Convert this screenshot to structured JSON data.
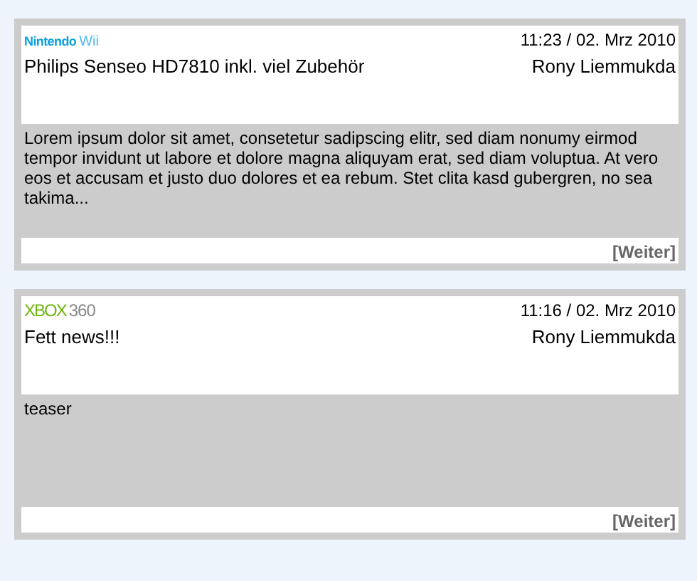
{
  "posts": [
    {
      "logo": {
        "kind": "wii",
        "brand": "Nintendo",
        "product": "Wii"
      },
      "time": "11:23 / 02. Mrz 2010",
      "title": "Philips Senseo HD7810 inkl. viel Zubehör",
      "author": "Rony Liemmukda",
      "teaser": "Lorem ipsum dolor sit amet, consetetur sadipscing elitr, sed diam nonumy eirmod tempor invidunt ut labore et dolore magna aliquyam erat, sed diam voluptua. At vero eos et accusam et justo duo dolores et ea rebum. Stet clita kasd gubergren, no sea takima...",
      "more": "[Weiter]"
    },
    {
      "logo": {
        "kind": "xbox",
        "brand": "XBOX",
        "product": "360"
      },
      "time": "11:16 / 02. Mrz 2010",
      "title": "Fett news!!!",
      "author": "Rony Liemmukda",
      "teaser": "teaser",
      "more": "[Weiter]"
    }
  ]
}
